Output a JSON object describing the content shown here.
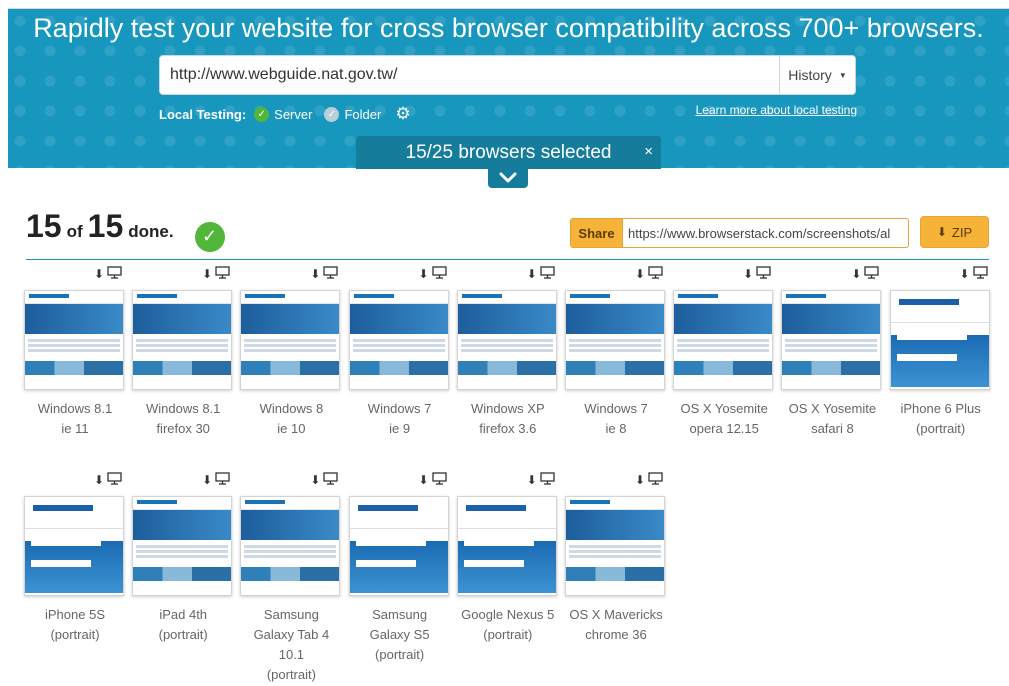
{
  "header": {
    "title": "Rapidly test your website for cross browser compatibility across 700+ browsers.",
    "url_value": "http://www.webguide.nat.gov.tw/",
    "history_label": "History",
    "local_testing_label": "Local Testing:",
    "server_label": "Server",
    "folder_label": "Folder",
    "learn_more": "Learn more about local testing",
    "selected_text": "15/25 browsers selected",
    "close_glyph": "×"
  },
  "status": {
    "done_count": "15",
    "of_text": "of",
    "total": "15",
    "done_text": "done."
  },
  "share": {
    "label": "Share",
    "url": "https://www.browserstack.com/screenshots/al",
    "zip_label": "ZIP"
  },
  "colors": {
    "hero": "#1796be",
    "accent_orange": "#f6b338",
    "success_green": "#52b63a"
  },
  "icons": {
    "download": "download-icon",
    "monitor": "monitor-icon"
  },
  "screenshots": [
    {
      "line1": "Windows 8.1",
      "line2": "ie 11",
      "kind": "desktop"
    },
    {
      "line1": "Windows 8.1",
      "line2": "firefox 30",
      "kind": "desktop"
    },
    {
      "line1": "Windows 8",
      "line2": "ie 10",
      "kind": "desktop"
    },
    {
      "line1": "Windows 7",
      "line2": "ie 9",
      "kind": "desktop"
    },
    {
      "line1": "Windows XP",
      "line2": "firefox 3.6",
      "kind": "desktop"
    },
    {
      "line1": "Windows 7",
      "line2": "ie 8",
      "kind": "desktop"
    },
    {
      "line1": "OS X Yosemite",
      "line2": "opera 12.15",
      "kind": "desktop"
    },
    {
      "line1": "OS X Yosemite",
      "line2": "safari 8",
      "kind": "desktop"
    },
    {
      "line1": "iPhone 6 Plus",
      "line2": "(portrait)",
      "kind": "mobile"
    },
    {
      "line1": "iPhone 5S",
      "line2": "(portrait)",
      "kind": "mobile"
    },
    {
      "line1": "iPad 4th",
      "line2": "(portrait)",
      "kind": "desktop"
    },
    {
      "line1": "Samsung",
      "line2": "Galaxy Tab 4",
      "line3": "10.1",
      "line4": "(portrait)",
      "kind": "desktop"
    },
    {
      "line1": "Samsung",
      "line2": "Galaxy S5",
      "line3": "(portrait)",
      "kind": "mobile"
    },
    {
      "line1": "Google Nexus 5",
      "line2": "(portrait)",
      "kind": "mobile"
    },
    {
      "line1": "OS X Mavericks",
      "line2": "chrome 36",
      "kind": "desktop"
    }
  ]
}
